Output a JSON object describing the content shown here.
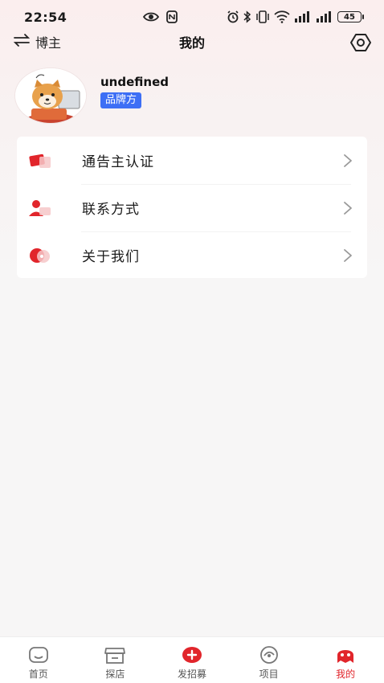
{
  "status_bar": {
    "time": "22:54",
    "battery": "45",
    "left_icons": [
      "eye-icon",
      "nfc-icon"
    ],
    "right_icons": [
      "alarm-icon",
      "bluetooth-icon",
      "vibrate-icon",
      "wifi-icon",
      "signal-icon",
      "signal-icon"
    ]
  },
  "nav": {
    "switch_label": "博主",
    "title": "我的"
  },
  "profile": {
    "username": "undefined",
    "role_badge": "品牌方"
  },
  "menu": {
    "items": [
      {
        "label": "通告主认证",
        "icon": "certification-icon"
      },
      {
        "label": "联系方式",
        "icon": "contact-icon"
      },
      {
        "label": "关于我们",
        "icon": "about-icon"
      }
    ]
  },
  "tabbar": {
    "tabs": [
      {
        "label": "首页",
        "icon": "home-icon"
      },
      {
        "label": "探店",
        "icon": "store-icon"
      },
      {
        "label": "发招募",
        "icon": "add-recruit-icon"
      },
      {
        "label": "项目",
        "icon": "project-icon"
      },
      {
        "label": "我的",
        "icon": "profile-icon"
      }
    ],
    "active_index": 4
  },
  "colors": {
    "accent_red": "#e1252b",
    "badge_blue": "#3d6ff5",
    "background": "#f7f6f6"
  }
}
